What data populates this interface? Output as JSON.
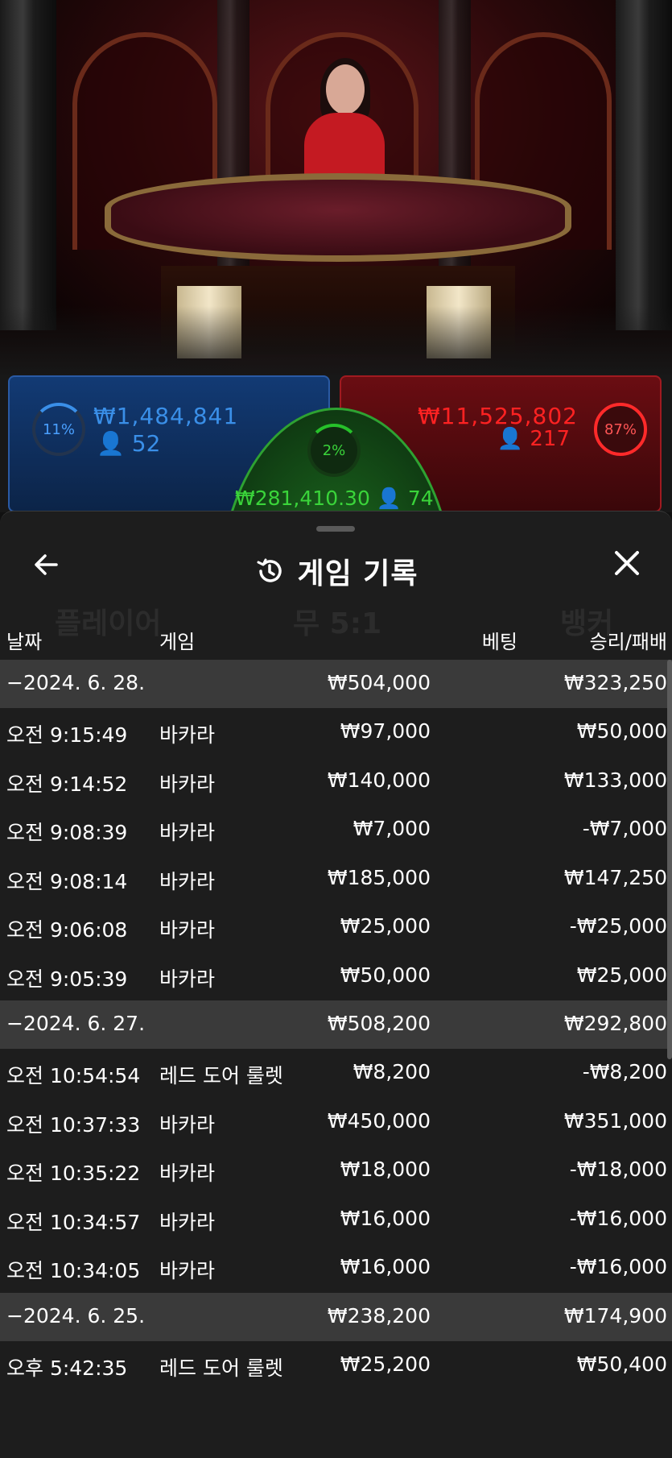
{
  "bets": {
    "player": {
      "percent": "11%",
      "amount": "₩1,484,841",
      "players": "52",
      "color": "#3a8fe8"
    },
    "tie": {
      "percent": "2%",
      "amount": "₩281,410.30",
      "players": "74",
      "color": "#3ad43a"
    },
    "banker": {
      "percent": "87%",
      "amount": "₩11,525,802",
      "players": "217",
      "color": "#ff2222"
    }
  },
  "sheet": {
    "title": "게임 기록",
    "back_icon": "arrow-left-icon",
    "history_icon": "history-clock-icon",
    "close_icon": "close-icon",
    "columns": {
      "date": "날짜",
      "game": "게임",
      "bet": "베팅",
      "result": "승리/패배"
    },
    "ghost": {
      "player": "플레이어",
      "tie": "무 5:1",
      "banker": "뱅커"
    }
  },
  "history": [
    {
      "type": "group",
      "date": "−2024. 6. 28.",
      "bet": "₩504,000",
      "result": "₩323,250"
    },
    {
      "type": "row",
      "date": "오전 9:15:49",
      "game": "바카라",
      "bet": "₩97,000",
      "result": "₩50,000"
    },
    {
      "type": "row",
      "date": "오전 9:14:52",
      "game": "바카라",
      "bet": "₩140,000",
      "result": "₩133,000"
    },
    {
      "type": "row",
      "date": "오전 9:08:39",
      "game": "바카라",
      "bet": "₩7,000",
      "result": "-₩7,000"
    },
    {
      "type": "row",
      "date": "오전 9:08:14",
      "game": "바카라",
      "bet": "₩185,000",
      "result": "₩147,250"
    },
    {
      "type": "row",
      "date": "오전 9:06:08",
      "game": "바카라",
      "bet": "₩25,000",
      "result": "-₩25,000"
    },
    {
      "type": "row",
      "date": "오전 9:05:39",
      "game": "바카라",
      "bet": "₩50,000",
      "result": "₩25,000"
    },
    {
      "type": "group",
      "date": "−2024. 6. 27.",
      "bet": "₩508,200",
      "result": "₩292,800"
    },
    {
      "type": "row",
      "date": "오전 10:54:54",
      "game": "레드 도어 룰렛",
      "bet": "₩8,200",
      "result": "-₩8,200"
    },
    {
      "type": "row",
      "date": "오전 10:37:33",
      "game": "바카라",
      "bet": "₩450,000",
      "result": "₩351,000"
    },
    {
      "type": "row",
      "date": "오전 10:35:22",
      "game": "바카라",
      "bet": "₩18,000",
      "result": "-₩18,000"
    },
    {
      "type": "row",
      "date": "오전 10:34:57",
      "game": "바카라",
      "bet": "₩16,000",
      "result": "-₩16,000"
    },
    {
      "type": "row",
      "date": "오전 10:34:05",
      "game": "바카라",
      "bet": "₩16,000",
      "result": "-₩16,000"
    },
    {
      "type": "group",
      "date": "−2024. 6. 25.",
      "bet": "₩238,200",
      "result": "₩174,900"
    },
    {
      "type": "row",
      "date": "오후 5:42:35",
      "game": "레드 도어 룰렛",
      "bet": "₩25,200",
      "result": "₩50,400"
    }
  ]
}
